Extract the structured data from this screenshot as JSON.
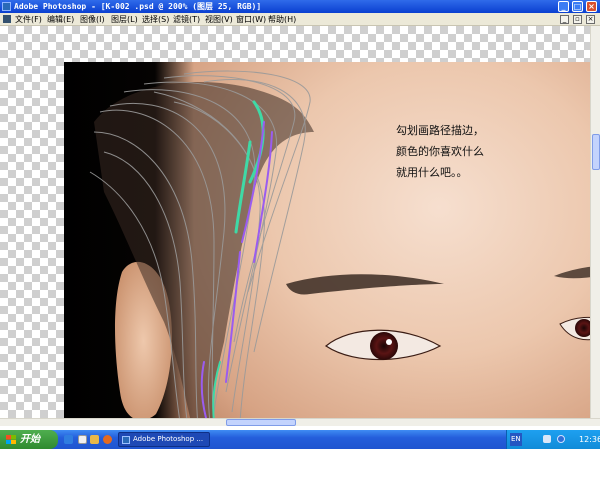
{
  "window": {
    "title": "Adobe Photoshop - [K-002 .psd @ 200% (图层 25, RGB)]",
    "buttons": {
      "minimize": "_",
      "maximize": "□",
      "close": "×"
    }
  },
  "menubar": {
    "items": [
      "文件(F)",
      "编辑(E)",
      "图像(I)",
      "图层(L)",
      "选择(S)",
      "滤镜(T)",
      "视图(V)",
      "窗口(W)",
      "帮助(H)"
    ],
    "doc_buttons": {
      "minimize": "_",
      "restore": "▫",
      "close": "×"
    }
  },
  "canvas": {
    "annotation_lines": [
      "勾划画路径描边，",
      "颜色的你喜欢什么",
      "就用什么吧。。"
    ]
  },
  "taskbar": {
    "start_label": "开始",
    "task_label": "Adobe Photoshop ...",
    "language": "EN",
    "clock": "12:36"
  },
  "colors": {
    "titlebar": "#0a3fd0",
    "taskbar": "#245edb",
    "start_button": "#3a9a3a",
    "hair_stroke_green": "#3fd9a6",
    "hair_stroke_purple": "#9a5cf0"
  },
  "icons": {
    "app": "photoshop-icon",
    "quick_launch": [
      "ie-icon",
      "media-player-icon",
      "desktop-icon",
      "firefox-icon"
    ],
    "tray": [
      "network-icon",
      "volume-icon"
    ]
  }
}
